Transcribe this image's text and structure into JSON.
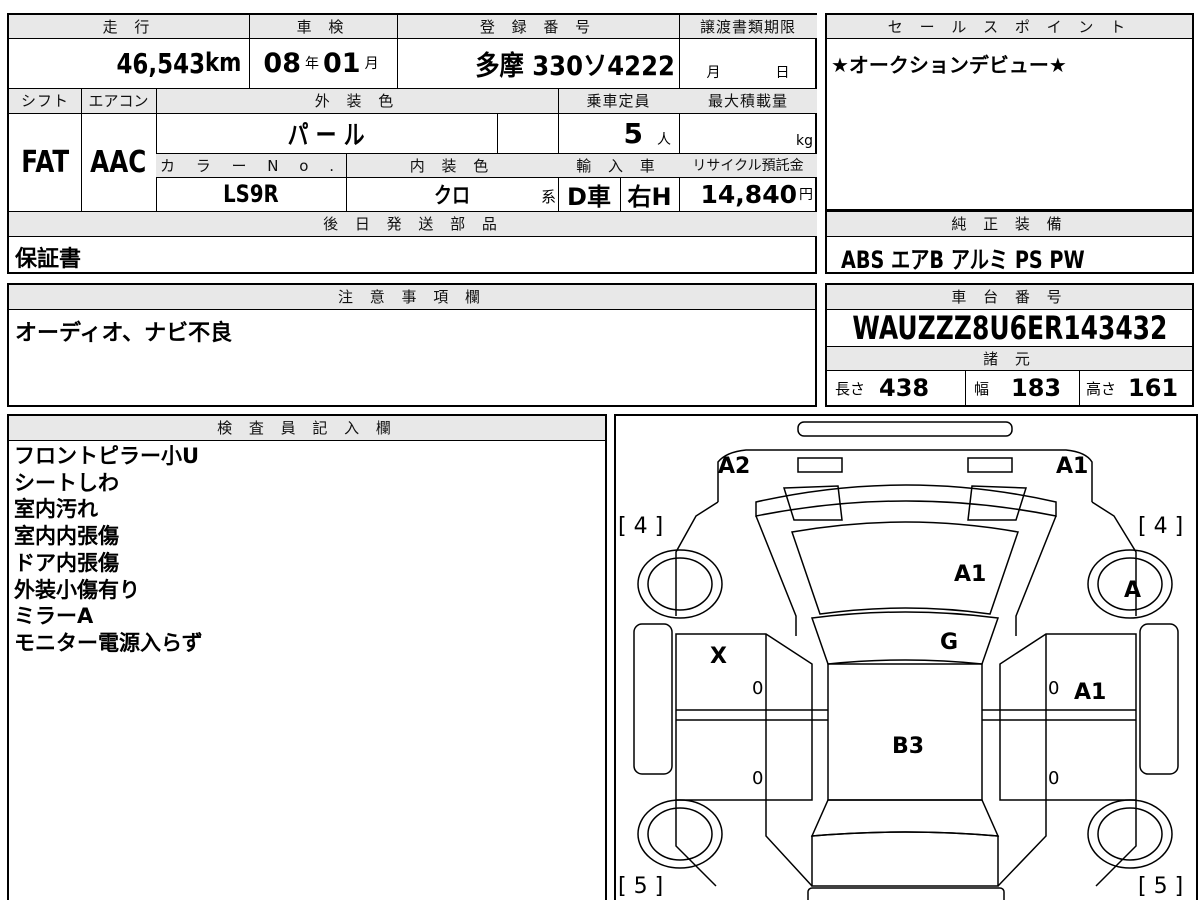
{
  "main_table": {
    "headers": {
      "mileage": "走 行",
      "inspection": "車 検",
      "registration": "登 録 番 号",
      "transfer_deadline": "譲渡書類期限",
      "shift": "シフト",
      "aircon": "エアコン",
      "exterior_color": "外 装 色",
      "capacity": "乗車定員",
      "max_load": "最大積載量",
      "color_no": "カ ラ ー N o .",
      "interior_color": "内 装 色",
      "import": "輸 入 車",
      "recycle": "リサイクル預託金",
      "later_parts": "後 日 発 送 部 品"
    },
    "mileage_value": "46,543",
    "mileage_unit": "km",
    "inspection_year": "08",
    "inspection_year_unit": "年",
    "inspection_month": "01",
    "inspection_month_unit": "月",
    "registration_value": "多摩 330ソ4222",
    "transfer_month_unit": "月",
    "transfer_day_unit": "日",
    "shift_value": "FAT",
    "aircon_value": "AAC",
    "exterior_color_value": "パ ー ル",
    "capacity_value": "5",
    "capacity_unit": "人",
    "max_load_unit": "kg",
    "color_no_value": "LS9R",
    "interior_color_value": "クロ",
    "interior_color_suffix": "系",
    "import_type": "D車",
    "handle_side": "右H",
    "recycle_value": "14,840",
    "recycle_unit": "円",
    "later_parts_value": "保証書"
  },
  "sales_point": {
    "header": "セ ー ル ス ポ イ ン ト",
    "text": "★オークションデビュー★"
  },
  "genuine_equipment": {
    "header": "純 正 装 備",
    "text": "ABS エアB アルミ PS PW"
  },
  "caution": {
    "header": "注 意 事 項 欄",
    "text": "オーディオ、ナビ不良"
  },
  "chassis": {
    "header": "車 台 番 号",
    "value": "WAUZZZ8U6ER143432",
    "spec_header": "諸 元",
    "length_label": "長さ",
    "length_value": "438",
    "width_label": "幅",
    "width_value": "183",
    "height_label": "高さ",
    "height_value": "161"
  },
  "inspector": {
    "header": "検 査 員 記 入 欄",
    "notes": [
      "フロントピラー小U",
      "シートしわ",
      "室内汚れ",
      "室内内張傷",
      "ドア内張傷",
      "外装小傷有り",
      "ミラーA",
      "モニター電源入らず"
    ]
  },
  "diagram": {
    "marks": {
      "a2_front_left": "A2",
      "a1_front_right": "A1",
      "tire_front_left": "[ 4 ]",
      "tire_front_right": "[ 4 ]",
      "hood": "A1",
      "front_right_wheel": "A",
      "windshield": "G",
      "left_front_door": "X",
      "right_front_door": "A1",
      "roof": "B3",
      "tire_rear_left": "[ 5 ]",
      "tire_rear_right": "[ 5 ]",
      "door_small_1": "0",
      "door_small_2": "0",
      "door_small_3": "0",
      "door_small_4": "0"
    }
  }
}
